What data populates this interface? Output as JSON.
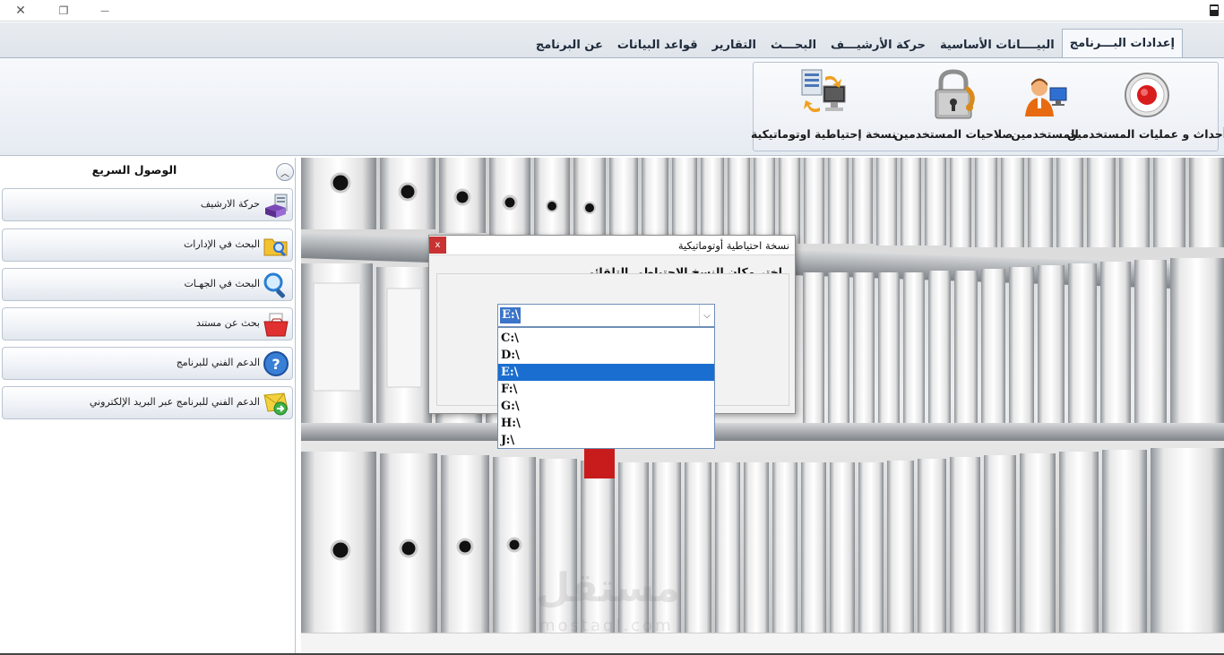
{
  "window": {
    "close_glyph": "✕",
    "restore_glyph": "❐",
    "minimize_glyph": "—"
  },
  "tabs": [
    {
      "label": "إعدادات البـــرنامج",
      "active": true
    },
    {
      "label": "البيــــانات الأساسية"
    },
    {
      "label": "حركة الأرشيـــف"
    },
    {
      "label": "البحـــث"
    },
    {
      "label": "التقارير"
    },
    {
      "label": "قواعد البيانات"
    },
    {
      "label": "عن البرنامج"
    }
  ],
  "ribbon": {
    "buttons": [
      {
        "label": "أحداث و عمليات المستخدمين",
        "icon": "record-icon"
      },
      {
        "label": "المستخدمين",
        "icon": "users-icon"
      },
      {
        "label": "صلاحيات المستخدمين",
        "icon": "lock-icon"
      },
      {
        "label": "نسخة إحتياطية اوتوماتيكية",
        "icon": "backup-icon"
      }
    ]
  },
  "sidebar": {
    "title": "الوصول السريع",
    "collapse_glyph": "︿",
    "items": [
      {
        "label": "حركة الارشيف",
        "icon": "archive-icon"
      },
      {
        "label": "البحث في الإدارات",
        "icon": "folder-search-icon"
      },
      {
        "label": "البحث في الجهـات",
        "icon": "magnifier-icon"
      },
      {
        "label": "بحث عن مستند",
        "icon": "document-folder-icon"
      },
      {
        "label": "الدعم الفني للبرنامج",
        "icon": "help-icon"
      },
      {
        "label": "الدعم الفني للبرنامج عبر البريد الإلكتروني",
        "icon": "email-icon"
      }
    ]
  },
  "watermark": {
    "text": "مستقل",
    "subtext": "mostaql.com"
  },
  "dialog": {
    "title": "نسخة احتياطية أوتوماتيكية",
    "close_glyph": "x",
    "heading": "اختر مكان النسخ الاحتياطي التلقائي",
    "combo": {
      "value": "E:\\",
      "arrow_glyph": "⌵",
      "options": [
        "C:\\",
        "D:\\",
        "E:\\",
        "F:\\",
        "G:\\",
        "H:\\",
        "J:\\"
      ],
      "selected_index": 2
    }
  },
  "colors": {
    "accent": "#1a6ed0",
    "close_red": "#c83232",
    "ribbon_border": "#a9b6c6"
  }
}
